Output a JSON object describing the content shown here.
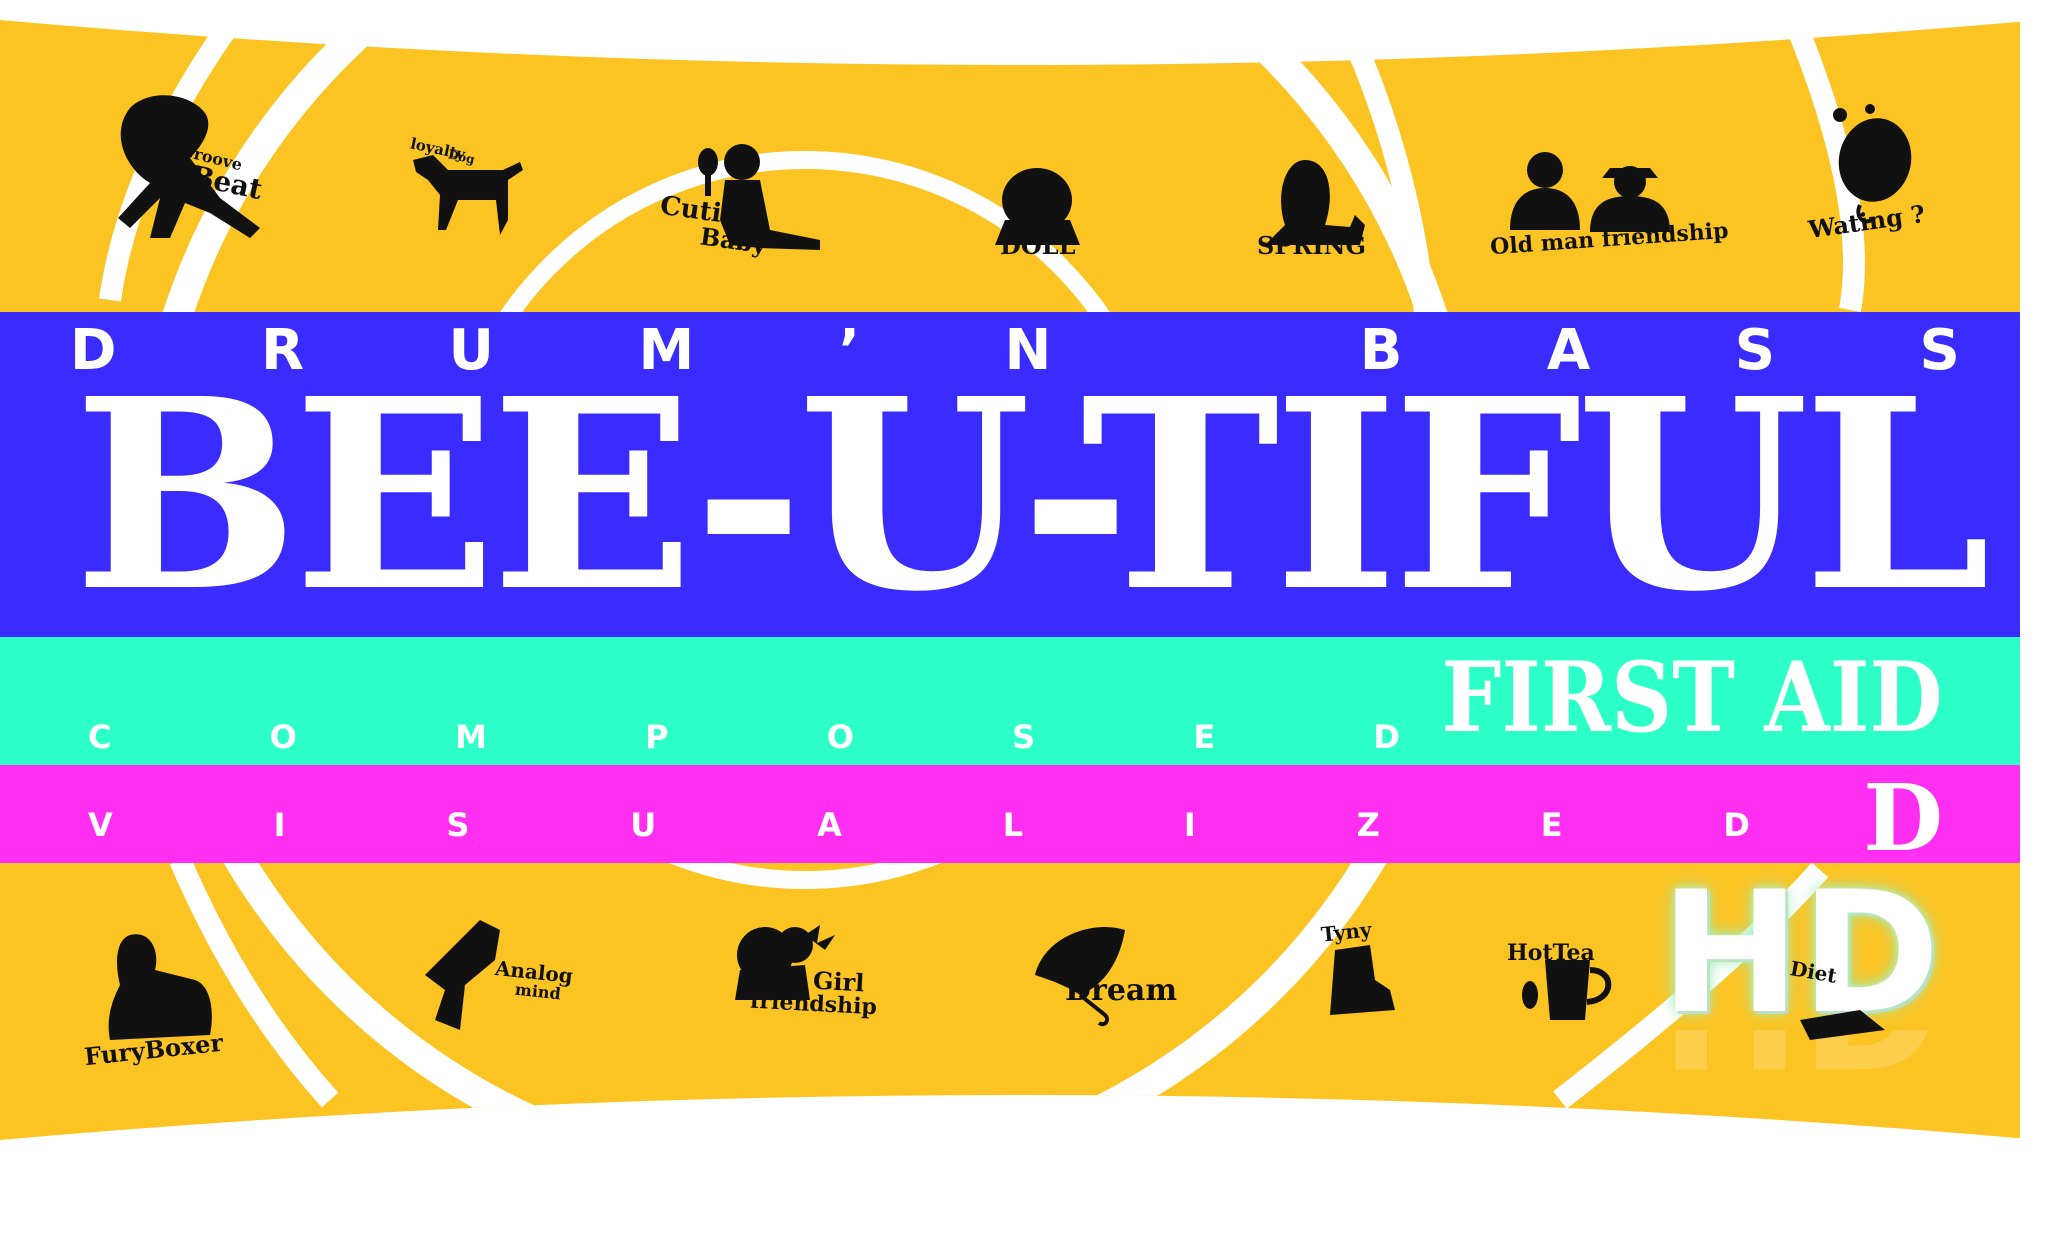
{
  "colors": {
    "yellow": "#fcc423",
    "blue": "#3a2cff",
    "cyan": "#2dffc8",
    "magenta": "#ff2ef0",
    "white": "#ffffff",
    "silhouette": "#111111"
  },
  "banner": {
    "top_line": [
      "D",
      "R",
      "U",
      "M",
      "’",
      "N",
      "B",
      "A",
      "S",
      "S"
    ],
    "title": "BEE-U-TIFUL",
    "composed_line": [
      "C",
      "O",
      "M",
      "P",
      "O",
      "S",
      "E",
      "D"
    ],
    "first_aid": "FIRST AID",
    "visualized_line": [
      "V",
      "I",
      "S",
      "U",
      "A",
      "L",
      "I",
      "Z",
      "E",
      "D"
    ],
    "visualized_tail": "D",
    "hd": "HD"
  },
  "top_icons": [
    {
      "id": "groove-beat",
      "label": "Groove Beat",
      "icon": "girl-guitar-icon"
    },
    {
      "id": "loyalty-dog",
      "label": "loyalty Dog",
      "icon": "dog-icon"
    },
    {
      "id": "cutie-baby",
      "label": "Cutie Baby",
      "icon": "baby-mirror-icon"
    },
    {
      "id": "doll",
      "label": "DOLL",
      "icon": "doll-icon"
    },
    {
      "id": "spring",
      "label": "SPRING",
      "icon": "woman-plant-icon"
    },
    {
      "id": "old-man-friendship",
      "label": "Old man friendship",
      "icon": "two-men-icon"
    },
    {
      "id": "waiting",
      "label": "Wating ?",
      "icon": "bird-egg-icon"
    }
  ],
  "bottom_icons": [
    {
      "id": "fury-boxer",
      "label": "FuryBoxer",
      "icon": "boxer-icon"
    },
    {
      "id": "analog-mind",
      "label": "Analog mind",
      "icon": "gramophone-icon"
    },
    {
      "id": "girl-friendship",
      "label": "Girl friendship",
      "icon": "girls-flowers-icon"
    },
    {
      "id": "dream",
      "label": "Dream",
      "icon": "umbrella-icon"
    },
    {
      "id": "tyny",
      "label": "Tyny",
      "icon": "tiny-creature-icon"
    },
    {
      "id": "hot-tea",
      "label": "HotTea",
      "icon": "teacup-icon"
    },
    {
      "id": "diet",
      "label": "Diet",
      "icon": "diet-icon"
    }
  ]
}
